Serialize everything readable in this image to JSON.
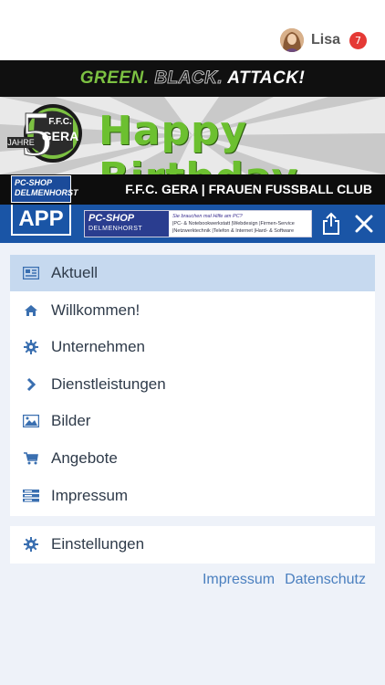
{
  "user": {
    "name": "Lisa",
    "notifications": "7"
  },
  "banner": {
    "slogan": {
      "green": "GREEN.",
      "black": "BLACK.",
      "attack": "ATTACK!"
    },
    "logo": {
      "number": "5",
      "jahre": "JAHRE",
      "ffc": "F.F.C.",
      "gera": "GERA"
    },
    "headline": "Happy Birthday",
    "club_line": "F.F.C. GERA | FRAUEN FUSSBALL CLUB",
    "pc_shop_logo": "PC-SHOP DELMENHORST"
  },
  "appbar": {
    "app_label": "APP",
    "ad": {
      "brand": "PC-SHOP",
      "brand_sub": "DELMENHORST",
      "tagline": "Sie brauchen mal Hilfe am PC?",
      "services": [
        "|PC- & Notebookwerkstatt",
        "|Webdesign",
        "|Firmen-Service",
        "|Netzwerktechnik",
        "|Telefon & Internet",
        "|Hard- & Software"
      ]
    },
    "share_icon": "share-icon",
    "close_icon": "close-icon"
  },
  "menu": {
    "items": [
      {
        "label": "Aktuell",
        "icon": "newspaper-icon",
        "active": true
      },
      {
        "label": "Willkommen!",
        "icon": "home-icon",
        "active": false
      },
      {
        "label": "Unternehmen",
        "icon": "gear-icon",
        "active": false
      },
      {
        "label": "Dienstleistungen",
        "icon": "chevron-right-icon",
        "active": false
      },
      {
        "label": "Bilder",
        "icon": "image-icon",
        "active": false
      },
      {
        "label": "Angebote",
        "icon": "cart-icon",
        "active": false
      },
      {
        "label": "Impressum",
        "icon": "server-icon",
        "active": false
      }
    ],
    "settings": {
      "label": "Einstellungen",
      "icon": "gear-icon"
    }
  },
  "footer": {
    "impressum": "Impressum",
    "datenschutz": "Datenschutz"
  },
  "colors": {
    "accent": "#1a55a6",
    "icon": "#3a6fb0",
    "active_bg": "#c6d9ef",
    "link": "#4a7fbf",
    "brand_green": "#7cc142",
    "badge": "#e53935"
  }
}
